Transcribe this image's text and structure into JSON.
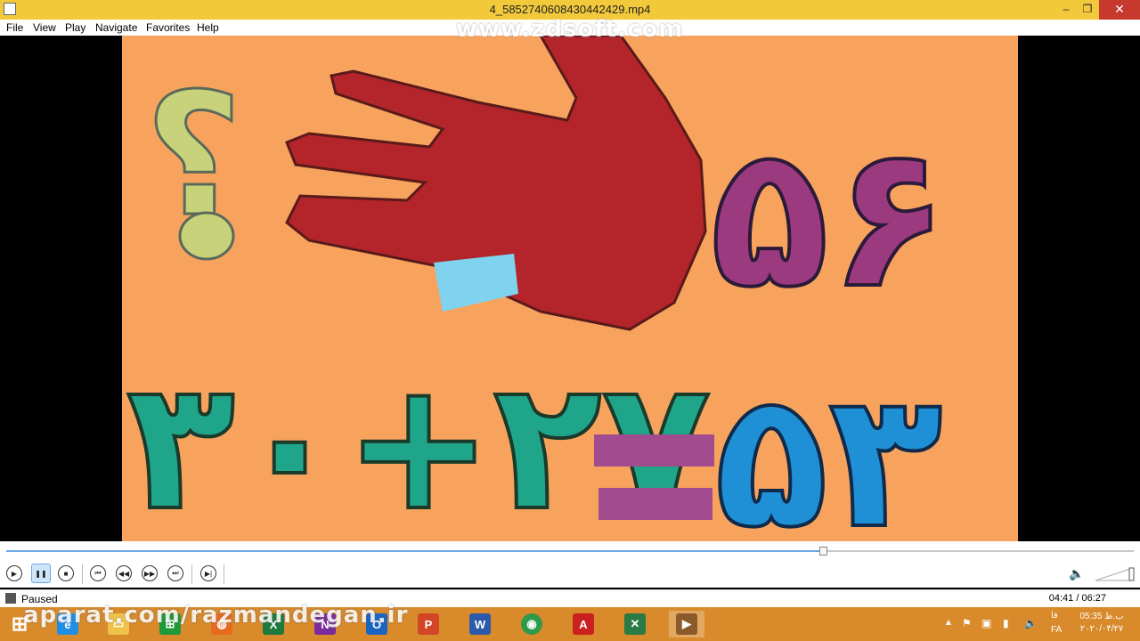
{
  "window": {
    "title": "4_5852740608430442429.mp4",
    "minimize": "–",
    "restore": "❐",
    "close": "✕"
  },
  "menu": {
    "items": [
      "File",
      "View",
      "Play",
      "Navigate",
      "Favorites",
      "Help"
    ]
  },
  "watermarks": {
    "top": "www.zdsoft.com",
    "bottom": "aparat.com/razmandegan.ir"
  },
  "video_content": {
    "question_mark": "؟",
    "top_row_digits": "۵۶",
    "equation_left": "۳۰+۲۷",
    "equals": "=",
    "result": "۵۳"
  },
  "playback": {
    "progress_fraction": 0.724,
    "status": "Paused",
    "time": "04:41 / 06:27"
  },
  "icons": {
    "play": "play-icon",
    "pause": "pause-icon",
    "stop": "stop-icon",
    "prev": "previous-icon",
    "rewind": "rewind-icon",
    "forward": "forward-icon",
    "next": "next-icon",
    "frame": "frame-step-icon",
    "volume": "volume-icon"
  },
  "taskbar": {
    "apps": [
      {
        "name": "start-button",
        "label": "⊞",
        "color": "#ffffff"
      },
      {
        "name": "internet-explorer",
        "label": "e",
        "color": "#1f8fe6"
      },
      {
        "name": "file-explorer",
        "label": "▭",
        "color": "#f0c24a"
      },
      {
        "name": "excel-green",
        "label": "⊞",
        "color": "#1f9a3a"
      },
      {
        "name": "firefox",
        "label": "◍",
        "color": "#e66b1f"
      },
      {
        "name": "excel",
        "label": "X",
        "color": "#1d7a3c"
      },
      {
        "name": "onenote",
        "label": "N",
        "color": "#7a2c9a"
      },
      {
        "name": "outlook",
        "label": "O",
        "color": "#1a64c2"
      },
      {
        "name": "powerpoint",
        "label": "P",
        "color": "#d24625"
      },
      {
        "name": "word",
        "label": "W",
        "color": "#2b5aab"
      },
      {
        "name": "chrome",
        "label": "◉",
        "color": "#2e9a4a"
      },
      {
        "name": "acrobat",
        "label": "A",
        "color": "#cc1f1f"
      },
      {
        "name": "app-green",
        "label": "✕",
        "color": "#2a7a46"
      },
      {
        "name": "media-player",
        "label": "▶",
        "color": "#8a5a2a"
      }
    ],
    "tray": {
      "lang": "FA",
      "lang_fa": "فا",
      "time": "05:35 ب.ظ",
      "date": "۲۰۲۰/۰۴/۲۷"
    }
  }
}
